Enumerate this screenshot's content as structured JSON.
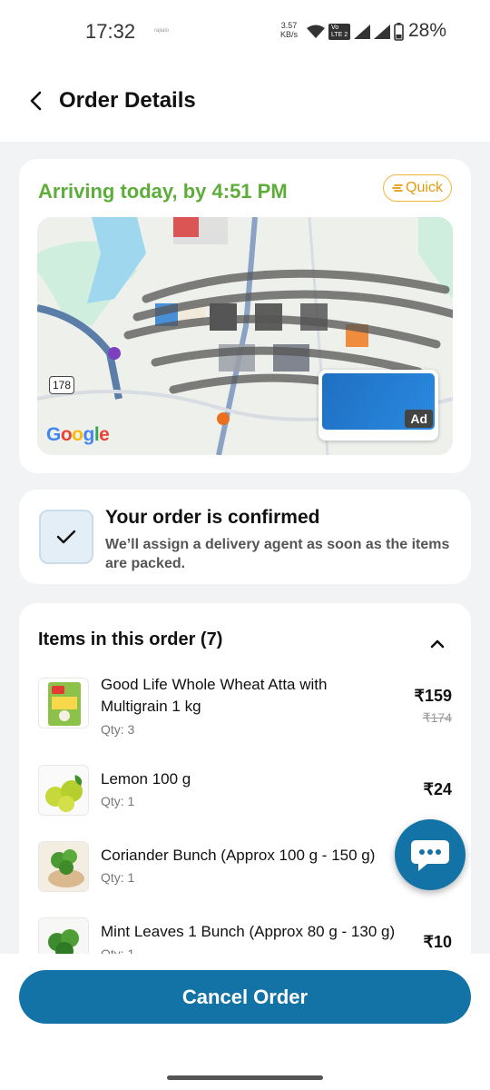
{
  "status_bar": {
    "time": "17:32",
    "mini_label": "rajialo",
    "net_speed_value": "3.57",
    "net_speed_unit": "KB/s",
    "volte_line1": "Vo",
    "volte_line2": "LTE 2",
    "battery_percent": "28%"
  },
  "header": {
    "title": "Order Details"
  },
  "delivery": {
    "eta_text": "Arriving today, by 4:51 PM",
    "badge_label": "Quick",
    "map_road_number": "178",
    "map_logo": "Google",
    "ad_label": "Ad"
  },
  "confirmation": {
    "title": "Your order is confirmed",
    "subtitle": "We’ll assign a delivery agent as soon as the items are packed."
  },
  "items_section": {
    "title": "Items in this order (7)",
    "items": [
      {
        "name": "Good Life Whole Wheat Atta with Multigrain 1 kg",
        "qty": "Qty: 3",
        "price": "₹159",
        "mrp": "₹174"
      },
      {
        "name": "Lemon 100 g",
        "qty": "Qty: 1",
        "price": "₹24"
      },
      {
        "name": "Coriander Bunch (Approx 100 g - 150 g)",
        "qty": "Qty: 1",
        "price": ""
      },
      {
        "name": "Mint Leaves 1 Bunch (Approx 80 g - 130 g)",
        "qty": "Qty: 1",
        "price": "₹10"
      }
    ]
  },
  "actions": {
    "cancel_label": "Cancel Order"
  },
  "colors": {
    "primary": "#1473a6",
    "eta_green": "#5cad3a",
    "quick_orange": "#e59a12"
  }
}
